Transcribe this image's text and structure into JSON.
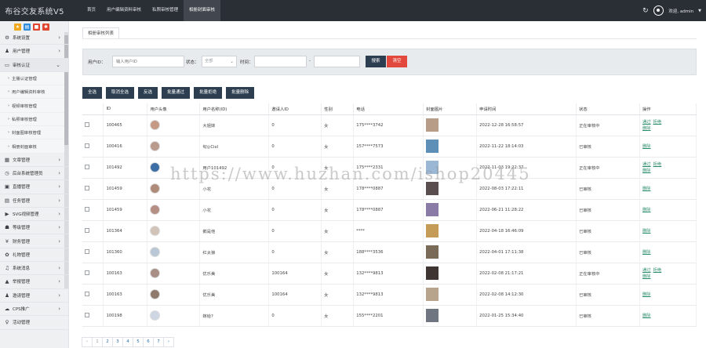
{
  "app": {
    "title": "布谷交友系统V5"
  },
  "topnav": {
    "tabs": [
      "首页",
      "用户编辑资料审核",
      "私照审核管理",
      "相册封面审核"
    ]
  },
  "header": {
    "welcome": "欢迎, admin"
  },
  "sidebar": {
    "items": [
      {
        "label": "系统设置",
        "icon": "gear-icon"
      },
      {
        "label": "用户管理",
        "icon": "user-icon"
      },
      {
        "label": "审核认证",
        "icon": "card-icon"
      }
    ],
    "subitems": [
      "主播认证管理",
      "用户编辑资料审核",
      "视频审核管理",
      "私照审核管理",
      "封面图审核管理",
      "相册封面审核"
    ],
    "items2": [
      {
        "label": "文章管理",
        "icon": "grid-icon"
      },
      {
        "label": "后台系统管理员",
        "icon": "clock-icon"
      },
      {
        "label": "直播管理",
        "icon": "camera-icon"
      },
      {
        "label": "任务管理",
        "icon": "task-icon"
      },
      {
        "label": "SVG视频管理",
        "icon": "play-icon"
      },
      {
        "label": "等级管理",
        "icon": "org-icon"
      },
      {
        "label": "财务管理",
        "icon": "money-icon"
      },
      {
        "label": "礼物管理",
        "icon": "gift-icon"
      },
      {
        "label": "系统消息",
        "icon": "bell-icon"
      },
      {
        "label": "举报管理",
        "icon": "warning-icon"
      },
      {
        "label": "邀请管理",
        "icon": "users-icon"
      },
      {
        "label": "CPS推广",
        "icon": "cloud-icon"
      },
      {
        "label": "活动管理",
        "icon": "bulb-icon"
      }
    ]
  },
  "page": {
    "tab": "相册审核列表"
  },
  "filter": {
    "uid_label": "用户ID：",
    "uid_placeholder": "输入用户ID",
    "status_label": "状态：",
    "status_value": "全部",
    "time_label": "时间：",
    "time_sep": "-",
    "search": "搜索",
    "clear": "清空"
  },
  "actions": [
    "全选",
    "取消全选",
    "反选",
    "批量通过",
    "批量拒绝",
    "批量删除"
  ],
  "table": {
    "headers": [
      "ID",
      "用户头像",
      "用户名称(ID)",
      "邀请人ID",
      "性别",
      "电话",
      "封面图片",
      "申请时间",
      "状态",
      "操作"
    ],
    "rows": [
      {
        "id": "100465",
        "name": "大姐妹",
        "inviter": "0",
        "gender": "女",
        "phone": "175****3742",
        "time": "2022-12-28 16:58:57",
        "status": "正在审核中",
        "ops": [
          "通过",
          "拒绝",
          "删除"
        ]
      },
      {
        "id": "100416",
        "name": "旬◎Ciel",
        "inviter": "0",
        "gender": "女",
        "phone": "157****7573",
        "time": "2022-11-22 18:14:03",
        "status": "已审核",
        "ops": [
          "删除"
        ]
      },
      {
        "id": "101492",
        "name": "用户101492",
        "inviter": "0",
        "gender": "女",
        "phone": "175****2331",
        "time": "2022-11-03 19:22:37",
        "status": "正在审核中",
        "ops": [
          "通过",
          "拒绝",
          "删除"
        ]
      },
      {
        "id": "101459",
        "name": "小花",
        "inviter": "0",
        "gender": "女",
        "phone": "178****0887",
        "time": "2022-08-03 17:22:11",
        "status": "已审核",
        "ops": [
          "删除"
        ]
      },
      {
        "id": "101459",
        "name": "小花",
        "inviter": "0",
        "gender": "女",
        "phone": "178****0887",
        "time": "2022-06-21 11:28:22",
        "status": "已审核",
        "ops": [
          "删除"
        ]
      },
      {
        "id": "101364",
        "name": "鹅是他",
        "inviter": "0",
        "gender": "女",
        "phone": "****",
        "time": "2022-04-18 16:46:09",
        "status": "已审核",
        "ops": [
          "删除"
        ]
      },
      {
        "id": "101360",
        "name": "红太狼",
        "inviter": "0",
        "gender": "女",
        "phone": "188****3536",
        "time": "2022-04-01 17:11:38",
        "status": "已审核",
        "ops": [
          "删除"
        ]
      },
      {
        "id": "100163",
        "name": "优乐美",
        "inviter": "100164",
        "gender": "女",
        "phone": "132****9813",
        "time": "2022-02-08 21:17:21",
        "status": "正在审核中",
        "ops": [
          "通过",
          "拒绝",
          "删除"
        ]
      },
      {
        "id": "100163",
        "name": "优乐美",
        "inviter": "100164",
        "gender": "女",
        "phone": "132****9813",
        "time": "2022-02-08 14:12:30",
        "status": "已审核",
        "ops": [
          "删除"
        ]
      },
      {
        "id": "100198",
        "name": "嫁给?",
        "inviter": "0",
        "gender": "女",
        "phone": "155****2201",
        "time": "2022-01-25 15:34:40",
        "status": "已审核",
        "ops": [
          "删除"
        ]
      }
    ]
  },
  "pager": [
    "‹",
    "1",
    "2",
    "3",
    "4",
    "5",
    "6",
    "7",
    "›"
  ],
  "watermark": "https://www.huzhan.com/ishop20445"
}
